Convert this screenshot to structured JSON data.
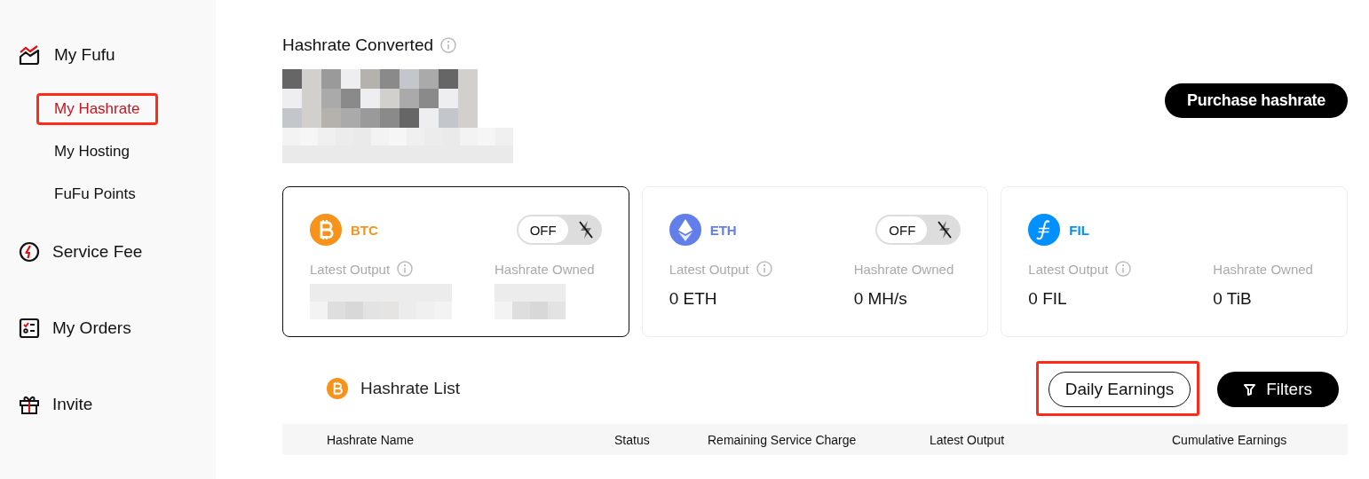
{
  "sidebar": {
    "items": [
      {
        "label": "My Fufu",
        "selected": false,
        "children": [
          {
            "label": "My Hashrate",
            "selected": true,
            "highlighted": true
          },
          {
            "label": "My Hosting",
            "selected": false,
            "highlighted": false
          },
          {
            "label": "FuFu Points",
            "selected": false,
            "highlighted": false
          }
        ]
      },
      {
        "label": "Service Fee",
        "selected": false
      },
      {
        "label": "My Orders",
        "selected": false
      },
      {
        "label": "Invite",
        "selected": false
      }
    ]
  },
  "summary": {
    "title": "Hashrate Converted",
    "purchase_button": "Purchase hashrate"
  },
  "coins": [
    {
      "symbol": "BTC",
      "color": "#f7931a",
      "selected": true,
      "toggle": {
        "label": "OFF",
        "on": false
      },
      "latest_output_label": "Latest Output",
      "hashrate_owned_label": "Hashrate Owned",
      "masked": true
    },
    {
      "symbol": "ETH",
      "color": "#627eea",
      "selected": false,
      "toggle": {
        "label": "OFF",
        "on": false
      },
      "latest_output_label": "Latest Output",
      "hashrate_owned_label": "Hashrate Owned",
      "masked": false,
      "latest_output": "0 ETH",
      "hashrate_owned": "0 MH/s"
    },
    {
      "symbol": "FIL",
      "color": "#0090ff",
      "selected": false,
      "latest_output_label": "Latest Output",
      "hashrate_owned_label": "Hashrate Owned",
      "masked": false,
      "latest_output": "0 FIL",
      "hashrate_owned": "0 TiB"
    }
  ],
  "hashrate_list": {
    "title": "Hashrate List",
    "buttons": [
      {
        "label": "Daily Earnings",
        "kind": "outline",
        "highlighted": true
      },
      {
        "label": "Filters",
        "kind": "filter",
        "highlighted": false
      }
    ],
    "columns": [
      "Hashrate Name",
      "Status",
      "Remaining Service Charge",
      "Latest Output",
      "Cumulative Earnings"
    ]
  }
}
